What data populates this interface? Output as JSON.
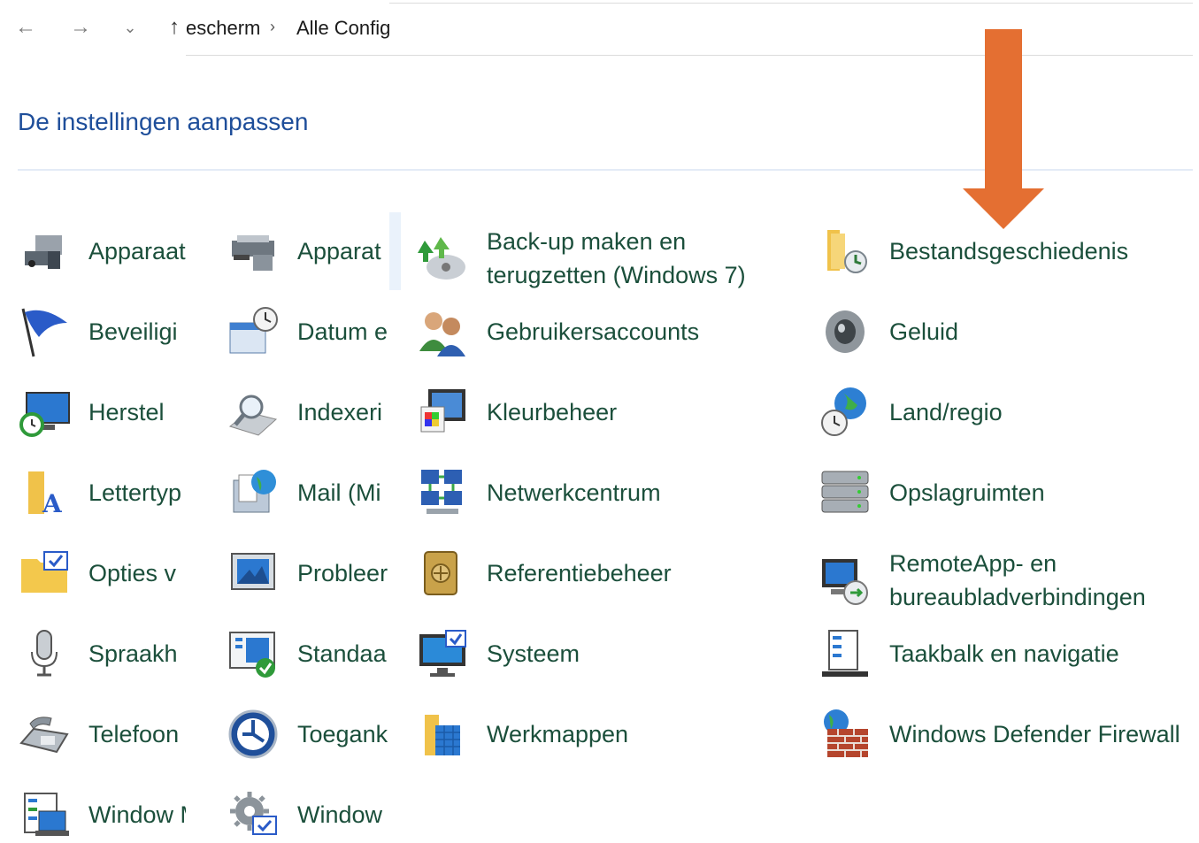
{
  "nav": {
    "breadcrumb": [
      "escherm",
      "Alle Config"
    ]
  },
  "heading": "De instellingen aanpassen",
  "items": [
    [
      "Apparaat",
      "Apparat",
      "Back-up maken en terugzetten (Windows 7)",
      "Bestandsgeschiedenis"
    ],
    [
      "Beveiligi",
      "Datum e",
      "Gebruikersaccounts",
      "Geluid"
    ],
    [
      "Herstel",
      "Indexeri",
      "Kleurbeheer",
      "Land/regio"
    ],
    [
      "Lettertyp",
      "Mail (Mi",
      "Netwerkcentrum",
      "Opslagruimten"
    ],
    [
      "Opties v",
      "Probleer",
      "Referentiebeheer",
      "RemoteApp- en bureaubladverbindingen"
    ],
    [
      "Spraakh",
      "Standaa",
      "Systeem",
      "Taakbalk en navigatie"
    ],
    [
      "Telefoon",
      "Toegank",
      "Werkmappen",
      "Windows Defender Firewall"
    ],
    [
      "Window Mobilitei",
      "Window",
      "",
      ""
    ]
  ],
  "colors": {
    "heading": "#1e4e9a",
    "link": "#1b4f3b",
    "arrow": "#e46f32"
  }
}
